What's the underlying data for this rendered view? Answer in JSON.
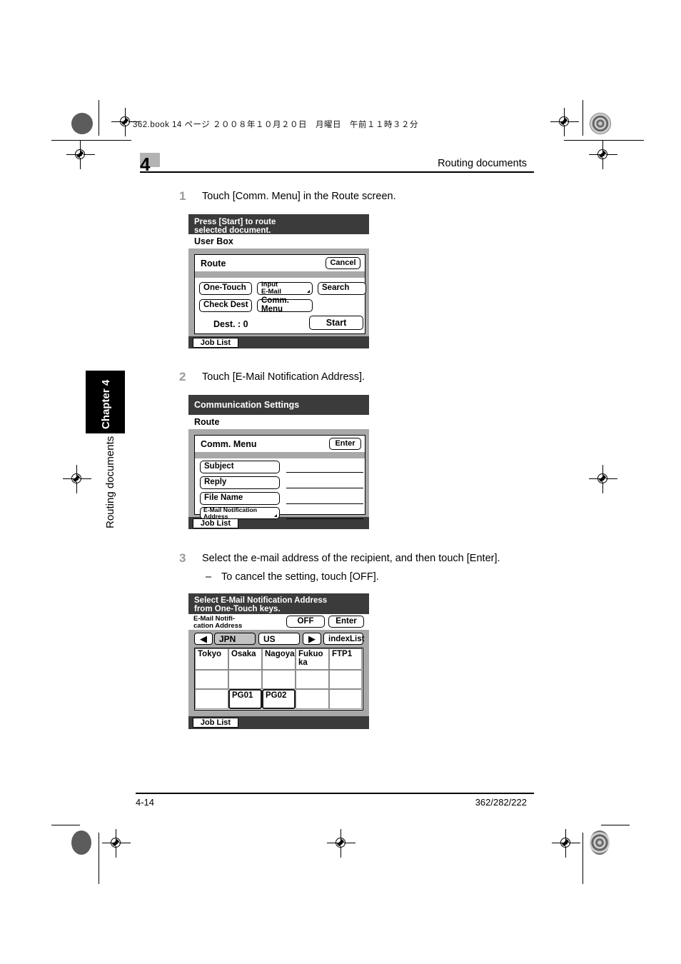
{
  "page": {
    "print_header": "362.book  14 ページ  ２００８年１０月２０日　月曜日　午前１１時３２分",
    "chapter_number": "4",
    "header_title": "Routing documents",
    "side_tab": "Chapter 4",
    "side_caption": "Routing documents",
    "footer_left": "4-14",
    "footer_right": "362/282/222"
  },
  "steps": [
    {
      "num": "1",
      "text": "Touch [Comm. Menu] in the Route screen."
    },
    {
      "num": "2",
      "text": "Touch [E-Mail Notification Address]."
    },
    {
      "num": "3",
      "text": "Select the e-mail address of the recipient, and then touch [Enter].",
      "sub_dash": "–",
      "sub_text": "To cancel the setting, touch [OFF]."
    }
  ],
  "panel1": {
    "title_line1": "Press [Start] to route",
    "title_line2": "selected document.",
    "subtitle": "User Box",
    "bar_label": "Route",
    "cancel": "Cancel",
    "buttons": [
      {
        "label": "One-Touch"
      },
      {
        "label_line1": "Input",
        "label_line2": "E-Mail"
      },
      {
        "label": "Search"
      },
      {
        "label": "Check Dest"
      },
      {
        "label": "Comm. Menu"
      }
    ],
    "dest_label": "Dest.  :   0",
    "start": "Start",
    "job_list": "Job List"
  },
  "panel2": {
    "title": "Communication Settings",
    "subtitle": "Route",
    "bar_label": "Comm. Menu",
    "enter": "Enter",
    "fields": [
      {
        "label": "Subject",
        "value": ""
      },
      {
        "label": "Reply",
        "value": ""
      },
      {
        "label": "File Name",
        "value": ""
      },
      {
        "label_line1": "E-Mail Notification",
        "label_line2": "Address",
        "value": ""
      }
    ],
    "job_list": "Job List"
  },
  "panel3": {
    "title_line1": "Select E-Mail Notification Address",
    "title_line2": "from One-Touch keys.",
    "bar_label_line1": "E-Mail Notifi-",
    "bar_label_line2": "cation Address",
    "off": "OFF",
    "enter": "Enter",
    "prev_arrow": "◀",
    "next_arrow": "▶",
    "tab_selected": "JPN",
    "tab_other": "US",
    "index_list": "indexList",
    "grid": {
      "rows": [
        [
          "Tokyo",
          "Osaka",
          "Nagoya",
          "Fukuo\nka",
          "FTP1"
        ],
        [
          "",
          "",
          "",
          "",
          ""
        ],
        [
          "",
          "PG01",
          "PG02",
          "",
          ""
        ]
      ],
      "key_cells": [
        "2-1",
        "2-2"
      ]
    },
    "job_list": "Job List"
  },
  "colors": {
    "panel_title_bg": "#3b3b3b",
    "panel_body_bg": "#a8a8a8",
    "chapter_box": "#b3b3b3",
    "step_number": "#9a9a9a"
  }
}
